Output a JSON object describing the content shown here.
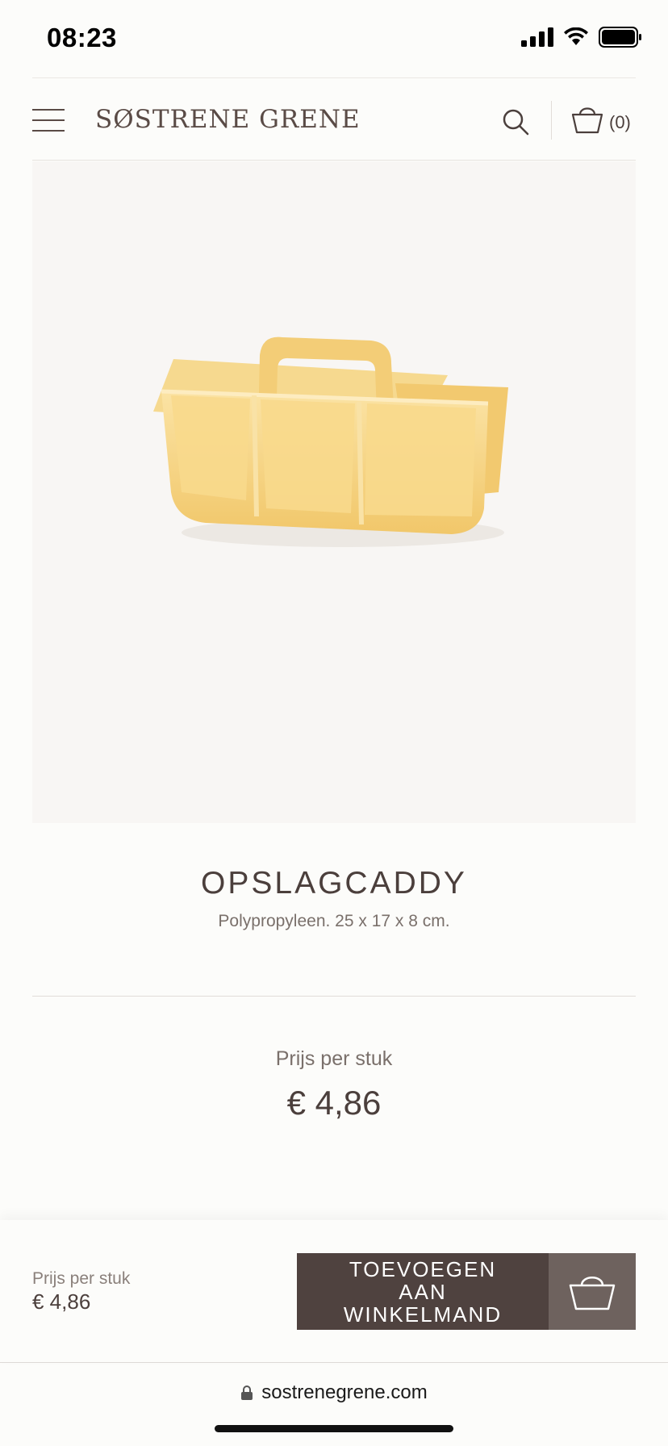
{
  "status_bar": {
    "time": "08:23",
    "icons": [
      "signal-icon",
      "wifi-icon",
      "battery-icon"
    ]
  },
  "header": {
    "logo_text": "SØSTRENE GRENE",
    "menu_icon": "hamburger-menu-icon",
    "search_icon": "search-icon",
    "cart_icon": "basket-icon",
    "cart_count": "(0)"
  },
  "product": {
    "image_alt": "Yellow storage caddy",
    "image_color": "#f6d27f",
    "title": "OPSLAGCADDY",
    "description": "Polypropyleen. 25 x 17 x 8 cm.",
    "price_label": "Prijs per stuk",
    "price": "€ 4,86"
  },
  "bottom_bar": {
    "price_label": "Prijs per stuk",
    "price": "€ 4,86",
    "add_to_cart_label": "TOEVOEGEN\nAAN\nWINKELMAND",
    "basket_icon": "basket-icon"
  },
  "browser": {
    "lock_icon": "lock-icon",
    "url": "sostrenegrene.com"
  },
  "colors": {
    "background": "#fcfcfa",
    "text_dark": "#4b3f3c",
    "button_primary": "#4f423f",
    "button_secondary": "#6e625e",
    "image_background": "#f8f6f4"
  }
}
